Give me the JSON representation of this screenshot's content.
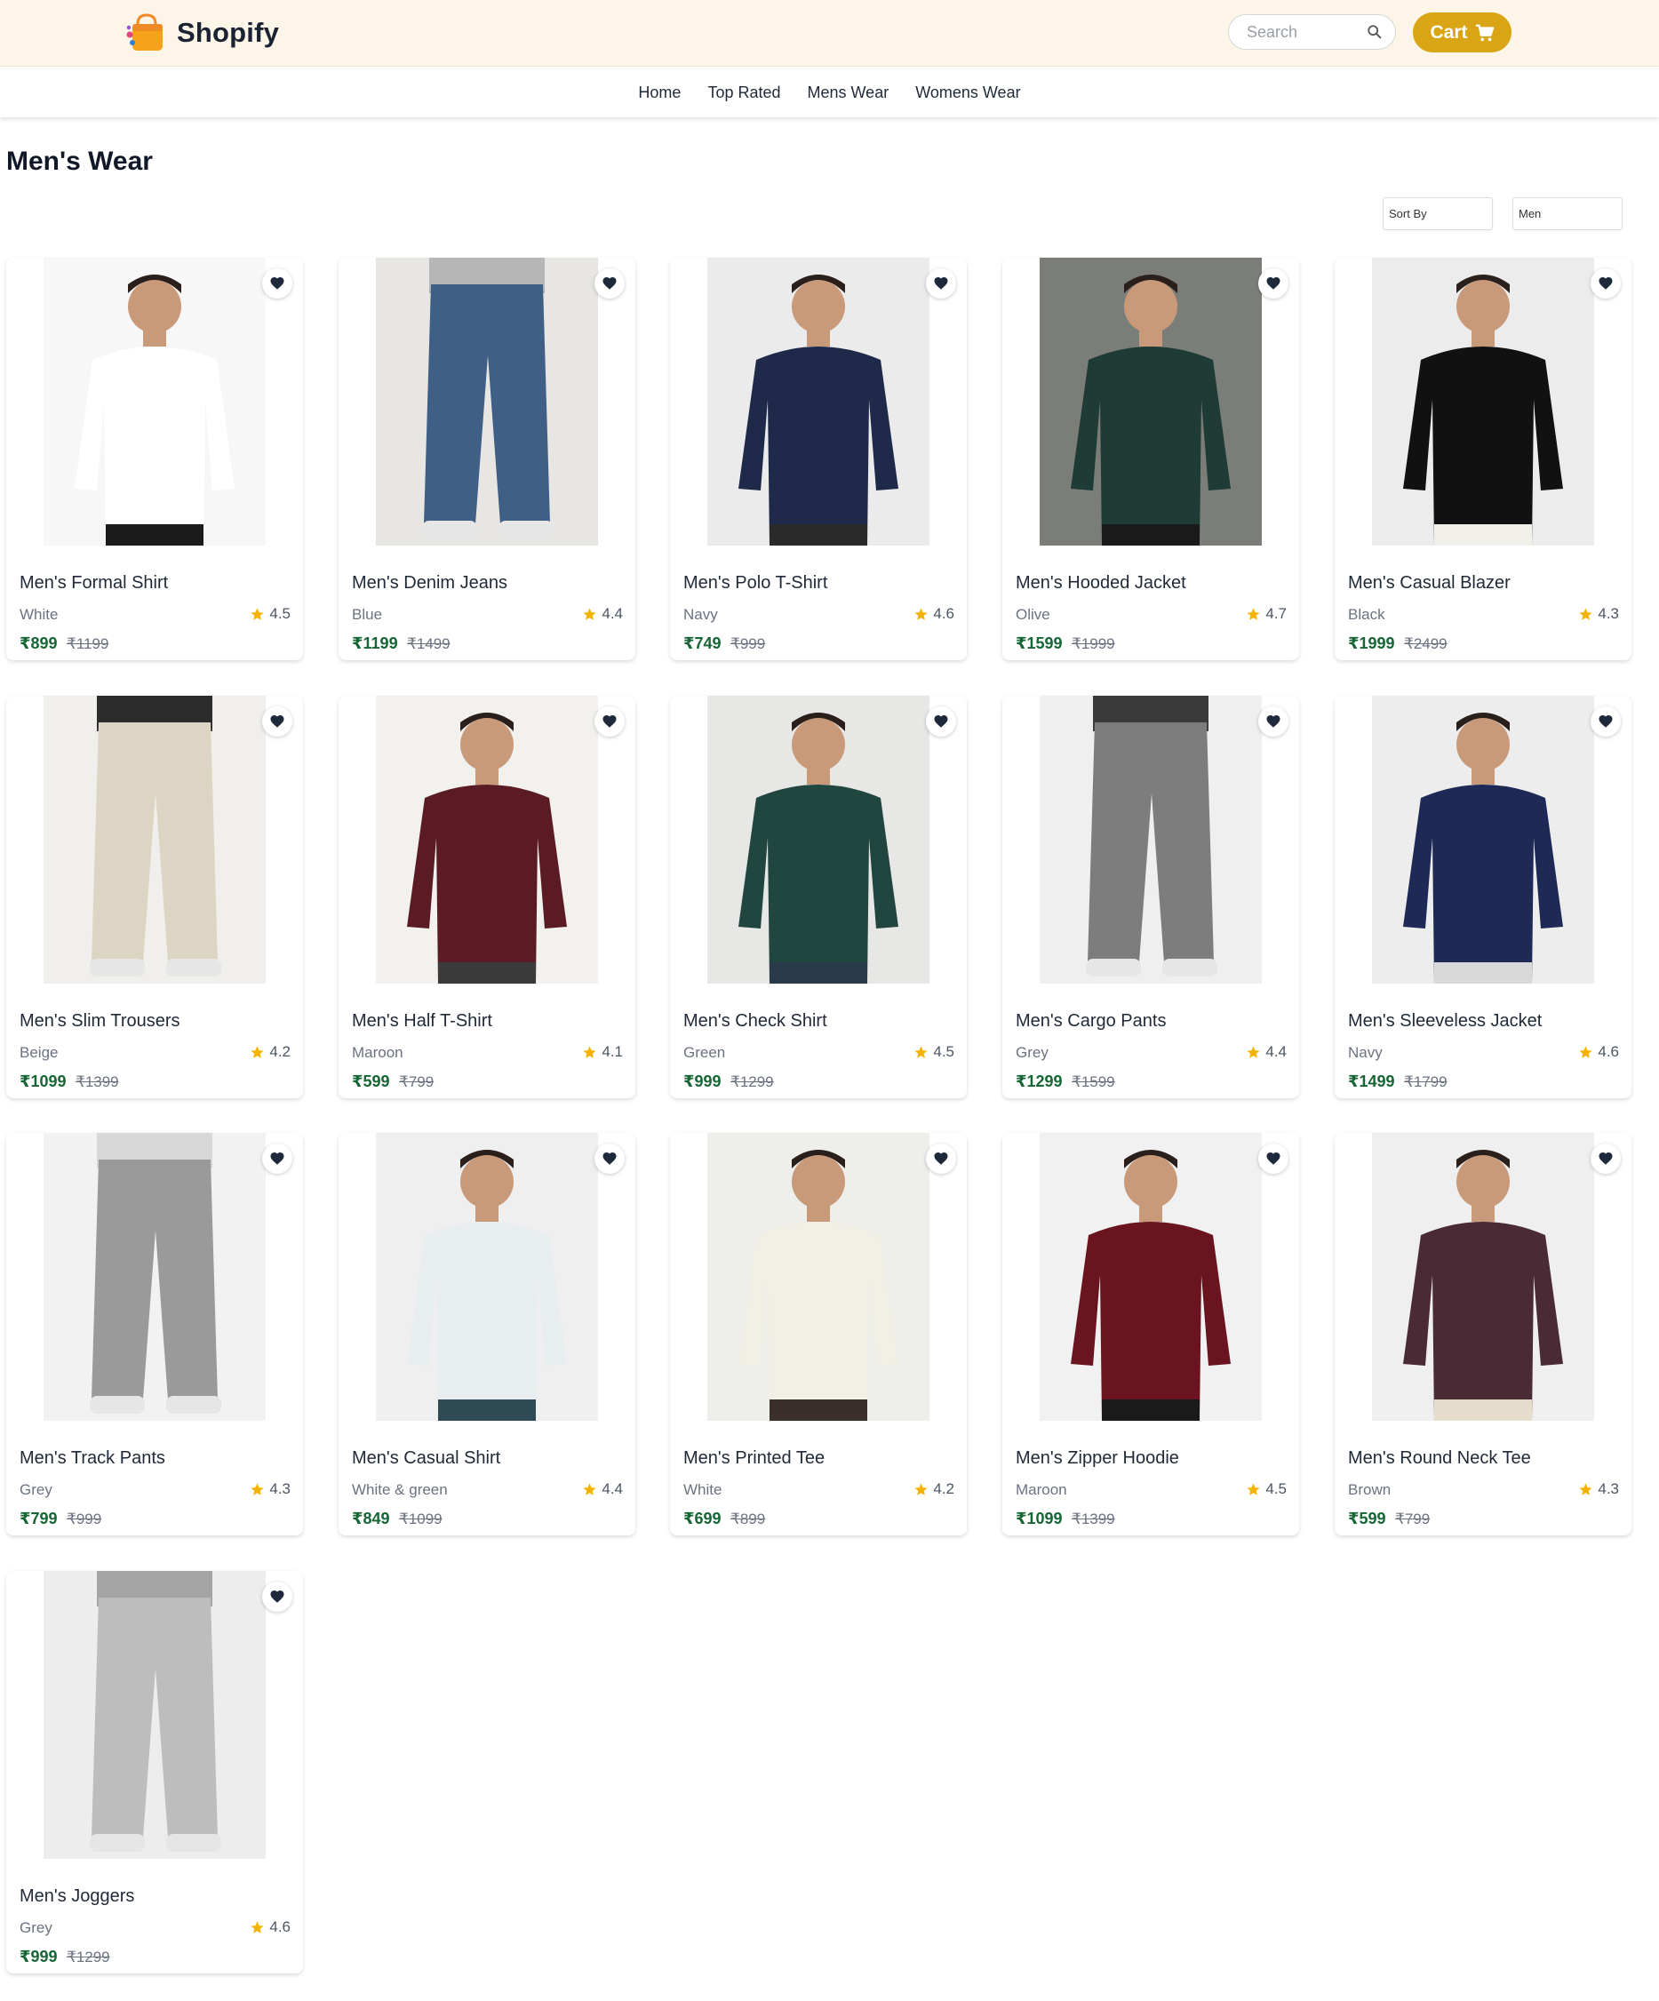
{
  "header": {
    "logo_text": "Shopify",
    "search_placeholder": "Search",
    "cart_label": "Cart"
  },
  "nav": [
    "Home",
    "Top Rated",
    "Mens Wear",
    "Womens Wear"
  ],
  "page_title": "Men's Wear",
  "filters": {
    "sort_label": "Sort By",
    "category": "Men"
  },
  "colors": {
    "header_bg": "#fdf5e8",
    "cart_button": "#d9a514",
    "price": "#166534",
    "star": "#f5b301"
  },
  "products": [
    {
      "name": "Men's Formal Shirt",
      "color": "White",
      "rating": "4.5",
      "price": "₹899",
      "old_price": "₹1199",
      "image_desc": "man in white formal shirt"
    },
    {
      "name": "Men's Denim Jeans",
      "color": "Blue",
      "rating": "4.4",
      "price": "₹1199",
      "old_price": "₹1499",
      "image_desc": "blue denim jeans"
    },
    {
      "name": "Men's Polo T-Shirt",
      "color": "Navy",
      "rating": "4.6",
      "price": "₹749",
      "old_price": "₹999",
      "image_desc": "man in navy polo"
    },
    {
      "name": "Men's Hooded Jacket",
      "color": "Olive",
      "rating": "4.7",
      "price": "₹1599",
      "old_price": "₹1999",
      "image_desc": "man in green puffer jacket"
    },
    {
      "name": "Men's Casual Blazer",
      "color": "Black",
      "rating": "4.3",
      "price": "₹1999",
      "old_price": "₹2499",
      "image_desc": "man in black blazer"
    },
    {
      "name": "Men's Slim Trousers",
      "color": "Beige",
      "rating": "4.2",
      "price": "₹1099",
      "old_price": "₹1399",
      "image_desc": "beige trousers on stool"
    },
    {
      "name": "Men's Half T-Shirt",
      "color": "Maroon",
      "rating": "4.1",
      "price": "₹599",
      "old_price": "₹799",
      "image_desc": "man in maroon t-shirt"
    },
    {
      "name": "Men's Check Shirt",
      "color": "Green",
      "rating": "4.5",
      "price": "₹999",
      "old_price": "₹1299",
      "image_desc": "man in green check shirt"
    },
    {
      "name": "Men's Cargo Pants",
      "color": "Grey",
      "rating": "4.4",
      "price": "₹1299",
      "old_price": "₹1599",
      "image_desc": "grey cargo pants"
    },
    {
      "name": "Men's Sleeveless Jacket",
      "color": "Navy",
      "rating": "4.6",
      "price": "₹1499",
      "old_price": "₹1799",
      "image_desc": "man in navy sleeveless jacket"
    },
    {
      "name": "Men's Track Pants",
      "color": "Grey",
      "rating": "4.3",
      "price": "₹799",
      "old_price": "₹999",
      "image_desc": "grey track pants"
    },
    {
      "name": "Men's Casual Shirt",
      "color": "White & green",
      "rating": "4.4",
      "price": "₹849",
      "old_price": "₹1099",
      "image_desc": "man in striped shirt"
    },
    {
      "name": "Men's Printed Tee",
      "color": "White",
      "rating": "4.2",
      "price": "₹699",
      "old_price": "₹899",
      "image_desc": "man in white printed sweatshirt"
    },
    {
      "name": "Men's Zipper Hoodie",
      "color": "Maroon",
      "rating": "4.5",
      "price": "₹1099",
      "old_price": "₹1399",
      "image_desc": "man in maroon zip hoodie"
    },
    {
      "name": "Men's Round Neck Tee",
      "color": "Brown",
      "rating": "4.3",
      "price": "₹599",
      "old_price": "₹799",
      "image_desc": "man in brown round neck tee"
    },
    {
      "name": "Men's Joggers",
      "color": "Grey",
      "rating": "4.6",
      "price": "₹999",
      "old_price": "₹1299",
      "image_desc": "grey joggers"
    }
  ]
}
